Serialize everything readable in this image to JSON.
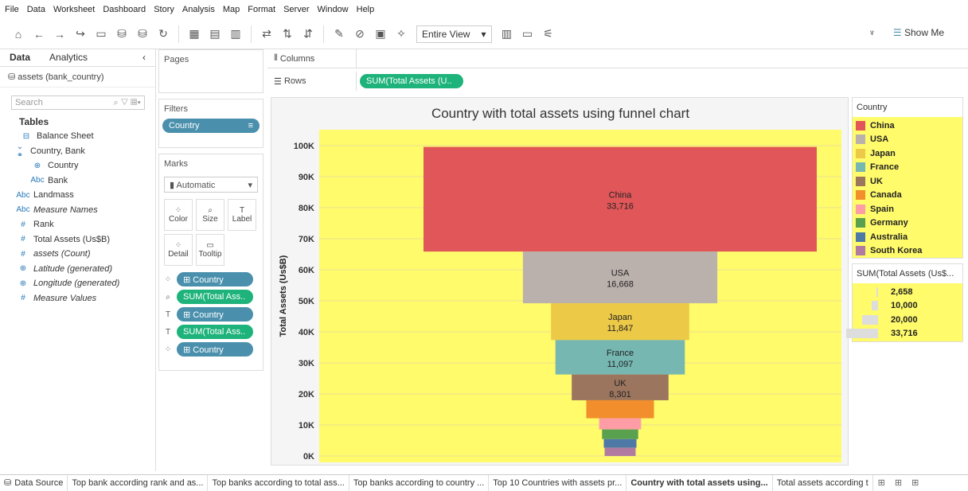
{
  "menu": [
    "File",
    "Data",
    "Worksheet",
    "Dashboard",
    "Story",
    "Analysis",
    "Map",
    "Format",
    "Server",
    "Window",
    "Help"
  ],
  "toolbar": {
    "view_select": "Entire View",
    "show_me": "Show Me"
  },
  "left": {
    "tab_data": "Data",
    "tab_analytics": "Analytics",
    "datasource": "assets (bank_country)",
    "search_placeholder": "Search",
    "tables_heading": "Tables",
    "fields": [
      {
        "icon": "⊟",
        "label": "Balance Sheet",
        "indent": 10,
        "italic": false
      },
      {
        "icon": "⌄ ⚭",
        "label": "Country, Bank",
        "indent": 2,
        "italic": false
      },
      {
        "icon": "⊕",
        "label": "Country",
        "indent": 24,
        "italic": false
      },
      {
        "icon": "Abc",
        "label": "Bank",
        "indent": 24,
        "italic": false
      },
      {
        "icon": "Abc",
        "label": "Landmass",
        "indent": 6,
        "italic": false
      },
      {
        "icon": "Abc",
        "label": "Measure Names",
        "indent": 6,
        "italic": true
      },
      {
        "icon": "#",
        "label": "Rank",
        "indent": 6,
        "italic": false
      },
      {
        "icon": "#",
        "label": "Total Assets (Us$B)",
        "indent": 6,
        "italic": false
      },
      {
        "icon": "#",
        "label": "assets (Count)",
        "indent": 6,
        "italic": true
      },
      {
        "icon": "⊕",
        "label": "Latitude (generated)",
        "indent": 6,
        "italic": true
      },
      {
        "icon": "⊕",
        "label": "Longitude (generated)",
        "indent": 6,
        "italic": true
      },
      {
        "icon": "#",
        "label": "Measure Values",
        "indent": 6,
        "italic": true
      }
    ]
  },
  "shelves": {
    "pages": "Pages",
    "filters": "Filters",
    "filter_pill": "Country",
    "marks": "Marks",
    "mark_type": "Automatic",
    "mark_buttons": [
      "Color",
      "Size",
      "Label",
      "Detail",
      "Tooltip"
    ],
    "mark_pills": [
      {
        "icon": "⁘",
        "label": "⊞ Country",
        "color": "blue"
      },
      {
        "icon": "⌕",
        "label": "SUM(Total Ass..",
        "color": "grn"
      },
      {
        "icon": "T",
        "label": "⊞ Country",
        "color": "blue"
      },
      {
        "icon": "T",
        "label": "SUM(Total Ass..",
        "color": "grn"
      },
      {
        "icon": "⁘",
        "label": "⊞ Country",
        "color": "blue"
      }
    ],
    "columns": "Columns",
    "rows": "Rows",
    "rows_pill": "SUM(Total Assets (U.."
  },
  "chart_data": {
    "type": "bar",
    "title": "Country with total assets using funnel chart",
    "ylabel": "Total Assets (Us$B)",
    "ylim": [
      0,
      105000
    ],
    "yticks": [
      "0K",
      "10K",
      "20K",
      "30K",
      "40K",
      "50K",
      "60K",
      "70K",
      "80K",
      "90K",
      "100K"
    ],
    "categories": [
      "China",
      "USA",
      "Japan",
      "France",
      "UK",
      "Canada",
      "Spain",
      "Germany",
      "Australia",
      "South Korea"
    ],
    "values": [
      33716,
      16668,
      11847,
      11097,
      8301,
      5800,
      3600,
      3100,
      2800,
      2658
    ],
    "colors": [
      "#e15759",
      "#bab0ac",
      "#edc948",
      "#76b7b2",
      "#9c755f",
      "#f28e2b",
      "#ff9da7",
      "#59a14f",
      "#4e79a7",
      "#b07aa1"
    ],
    "labels_shown": [
      "China",
      "USA",
      "Japan",
      "France",
      "UK"
    ],
    "background": "#fffb6b"
  },
  "legend": {
    "title": "Country",
    "size_title": "SUM(Total Assets (Us$...",
    "size_values": [
      "2,658",
      "10,000",
      "20,000",
      "33,716"
    ]
  },
  "tabs": [
    "Data Source",
    "Top bank according rank and as...",
    "Top banks according to total ass...",
    "Top banks according to country ...",
    "Top 10 Countries with assets pr...",
    "Country with total assets using...",
    "Total assets according t"
  ],
  "active_tab": 5
}
